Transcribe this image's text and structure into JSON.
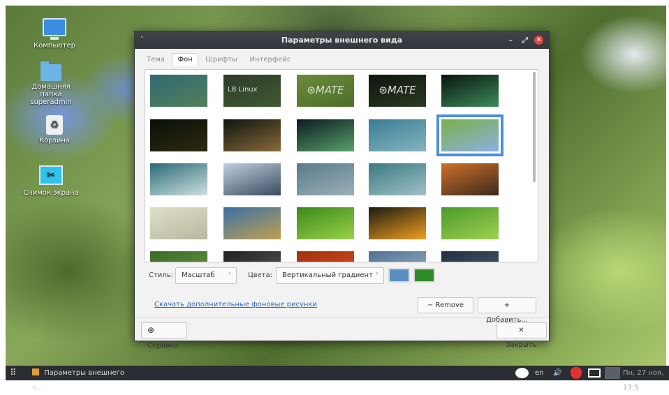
{
  "desktop": {
    "icons": [
      {
        "label": "Компьютер",
        "icon": "monitor-icon"
      },
      {
        "label": "Домашняя папка superadmin",
        "icon": "home-folder-icon"
      },
      {
        "label": "Корзина",
        "icon": "trash-icon"
      },
      {
        "label": "Снимок экрана",
        "icon": "screenshot-icon"
      }
    ]
  },
  "window": {
    "title": "Параметры внешнего вида",
    "menu_glyph": "˅",
    "minimize_glyph": "–",
    "maximize_glyph": "⤢",
    "close_glyph": "×",
    "tabs": [
      "Тема",
      "Фон",
      "Шрифты",
      "Интерфейс"
    ],
    "active_tab": "Фон",
    "wallpapers": [
      {
        "name": "teal-gradient",
        "colors": [
          "#2f6a73",
          "#537f5a"
        ]
      },
      {
        "name": "lb-linux",
        "colors": [
          "#2f3b2a",
          "#3f5a30"
        ],
        "text": "LB Linux"
      },
      {
        "name": "mate-green",
        "colors": [
          "#6a8a3a",
          "#4e6f2a"
        ],
        "text": "⊛MATE"
      },
      {
        "name": "mate-dark",
        "colors": [
          "#101510",
          "#2a3a20"
        ],
        "text": "⊛MATE"
      },
      {
        "name": "aurora-1",
        "colors": [
          "#07150e",
          "#3d8a5a"
        ]
      },
      {
        "name": "dark-bokeh",
        "colors": [
          "#0a0f0a",
          "#2c2a10"
        ]
      },
      {
        "name": "aurora-2",
        "colors": [
          "#0d1410",
          "#8a6a3a"
        ]
      },
      {
        "name": "aurora-3",
        "colors": [
          "#0a1a20",
          "#5aa06a"
        ]
      },
      {
        "name": "blue-waves",
        "colors": [
          "#3a7c94",
          "#86b4c0"
        ]
      },
      {
        "name": "forget-me-not",
        "colors": [
          "#7bb04a",
          "#8ab0e0"
        ]
      },
      {
        "name": "teal-waves",
        "colors": [
          "#2a6a78",
          "#cfe0e0"
        ]
      },
      {
        "name": "water-drop",
        "colors": [
          "#c0d0e0",
          "#3a4a60"
        ]
      },
      {
        "name": "grey-curves",
        "colors": [
          "#5a7a8a",
          "#9ab0b8"
        ]
      },
      {
        "name": "teal-light",
        "colors": [
          "#3a7a80",
          "#a0c0c8"
        ]
      },
      {
        "name": "orange-flower",
        "colors": [
          "#d0702a",
          "#3a2a1a"
        ]
      },
      {
        "name": "sand",
        "colors": [
          "#e0e0c8",
          "#b8b8a0"
        ]
      },
      {
        "name": "beach",
        "colors": [
          "#3a70a8",
          "#c0a050"
        ]
      },
      {
        "name": "green-leaf",
        "colors": [
          "#3a8a1a",
          "#9ad04a"
        ]
      },
      {
        "name": "yellow-flower",
        "colors": [
          "#1a1a10",
          "#f0a020"
        ]
      },
      {
        "name": "grass",
        "colors": [
          "#4a9a2a",
          "#a0d050"
        ]
      },
      {
        "name": "partial-1",
        "colors": [
          "#3a6a2a",
          "#6a9a3a"
        ]
      },
      {
        "name": "partial-2",
        "colors": [
          "#202020",
          "#606060"
        ]
      },
      {
        "name": "partial-3",
        "colors": [
          "#a03010",
          "#e05020"
        ]
      },
      {
        "name": "partial-4",
        "colors": [
          "#507090",
          "#a0b8d0"
        ]
      },
      {
        "name": "partial-5",
        "colors": [
          "#203040",
          "#506070"
        ]
      }
    ],
    "selected_wallpaper": "forget-me-not",
    "style_label": "Стиль:",
    "style_value": "Масштаб",
    "colors_label": "Цвета:",
    "colors_value": "Вертикальный градиент",
    "color_primary": "#5b8fc4",
    "color_secondary": "#2f8a2a",
    "chevron_glyph": "˅",
    "download_link": "Скачать дополнительные фоновые рисунки",
    "remove_button": "− Remove",
    "add_button": "+ Добавить...",
    "help_button": "Справка",
    "help_glyph": "⊕",
    "close_button": "✕ Закрыть"
  },
  "taskbar": {
    "apps_glyph": "⠿",
    "task_label": "Параметры внешнего в...",
    "lang": "en",
    "volume_glyph": "🔊",
    "clock": "Пн, 27 ноя, 13:5"
  }
}
